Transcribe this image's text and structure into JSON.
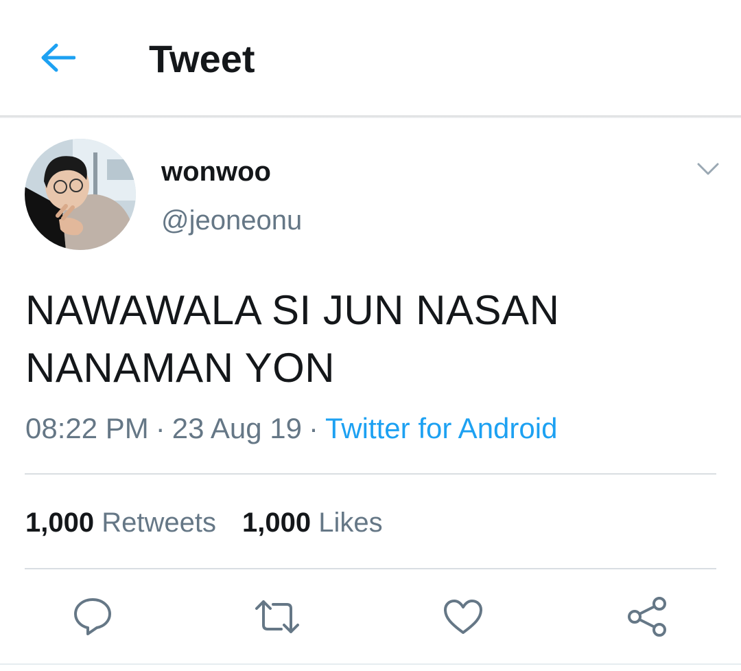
{
  "header": {
    "title": "Tweet",
    "back_icon": "arrow-left-icon"
  },
  "tweet": {
    "author": {
      "name": "wonwoo",
      "handle": "@jeoneonu"
    },
    "text_lines": [
      "NAWAWALA SI JUN NASAN",
      "NANAMAN YON"
    ],
    "time": "08:22 PM",
    "date": "23 Aug 19",
    "separator": "·",
    "source": "Twitter for Android",
    "stats": {
      "retweets_count": "1,000",
      "retweets_label": "Retweets",
      "likes_count": "1,000",
      "likes_label": "Likes"
    },
    "actions": [
      "reply-icon",
      "retweet-icon",
      "like-icon",
      "share-icon"
    ]
  },
  "colors": {
    "accent": "#1da1f2",
    "text": "#14171a",
    "secondary": "#657786",
    "divider": "#d9dee2"
  }
}
